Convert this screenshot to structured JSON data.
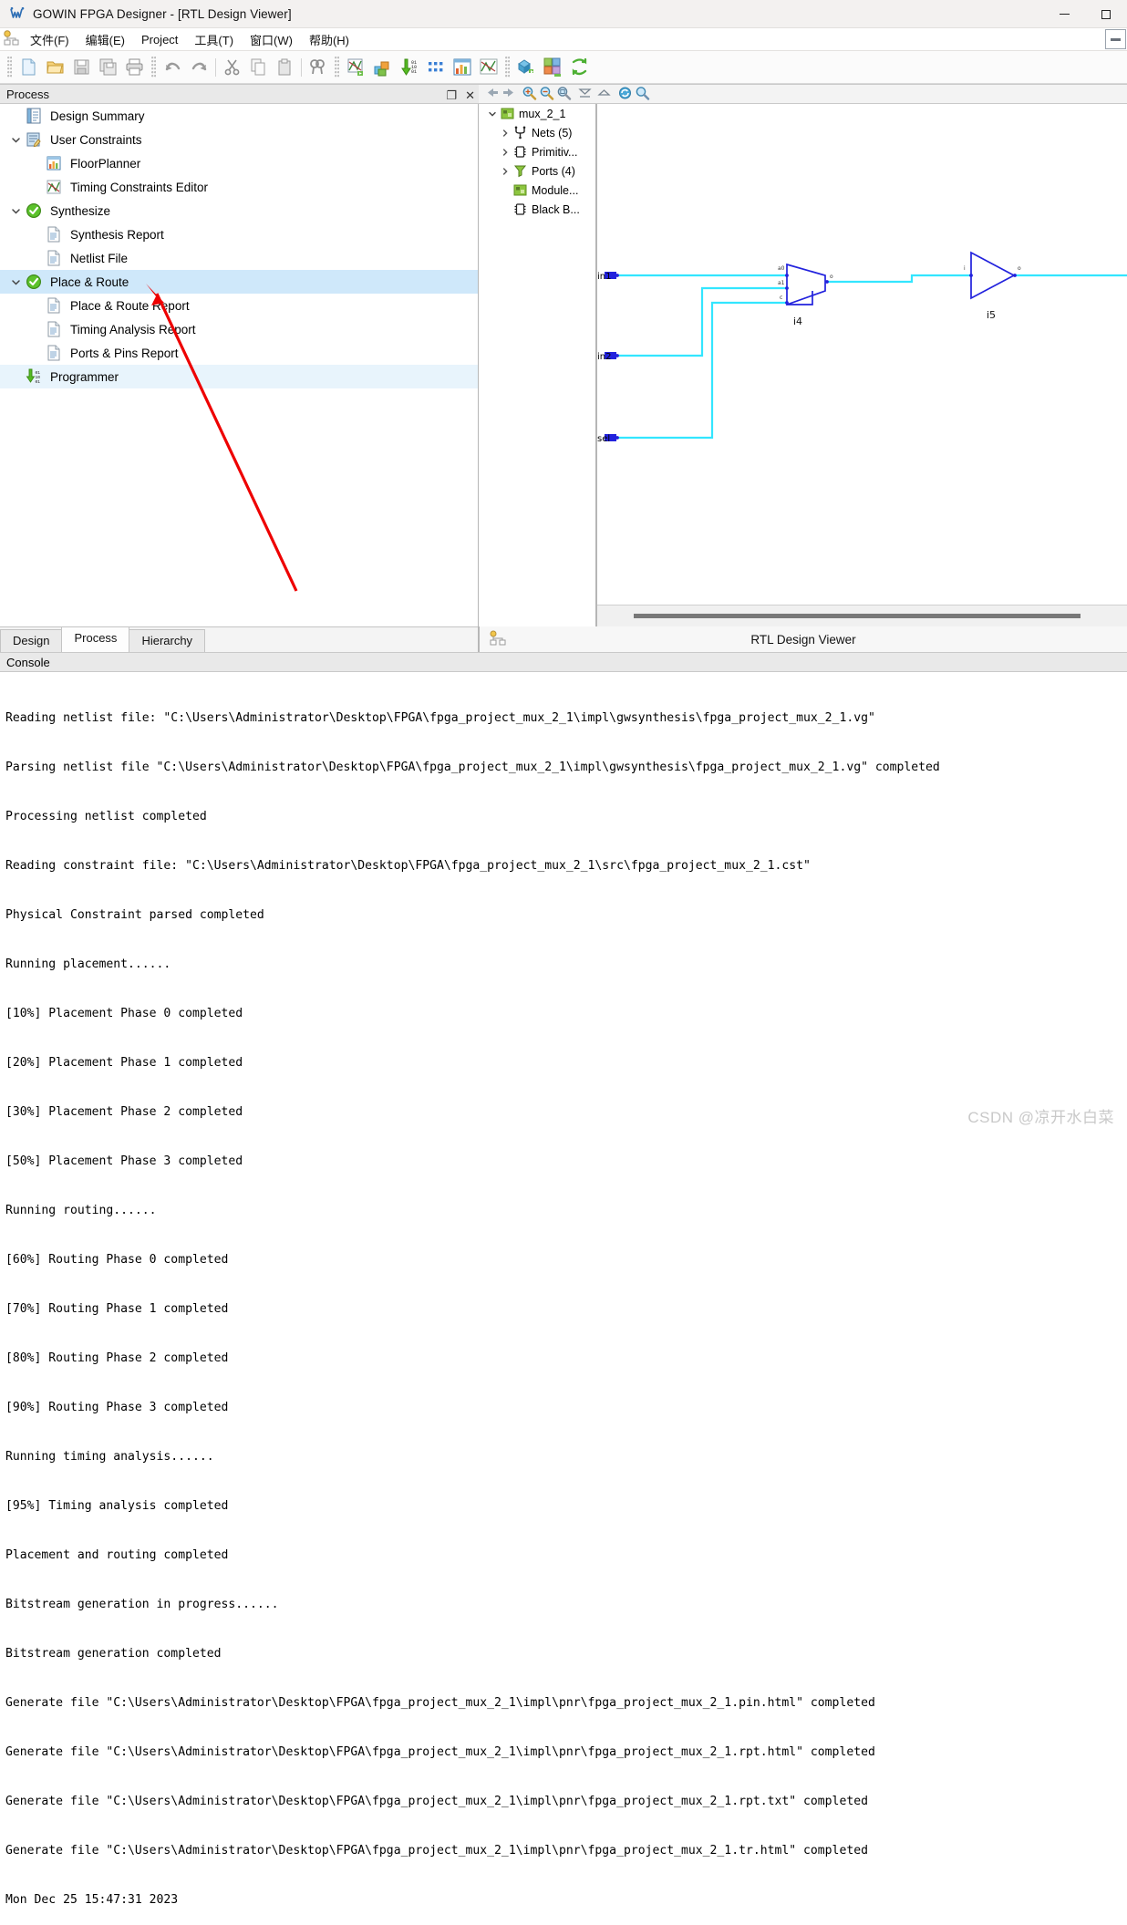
{
  "window": {
    "title": "GOWIN FPGA Designer - [RTL Design Viewer]",
    "logo_icon": "gowin-logo-icon",
    "minimize_label": "minimize-icon",
    "maximize_label": "maximize-icon"
  },
  "menubar": {
    "grip_icon": "menu-grip-icon",
    "items": [
      {
        "label": "文件(F)",
        "mnemonic": "F"
      },
      {
        "label": "编辑(E)",
        "mnemonic": "E"
      },
      {
        "label": "Project",
        "mnemonic": "P"
      },
      {
        "label": "工具(T)",
        "mnemonic": "T"
      },
      {
        "label": "窗口(W)",
        "mnemonic": "W"
      },
      {
        "label": "帮助(H)",
        "mnemonic": "H"
      }
    ],
    "right_button_icon": "restore-window-icon"
  },
  "toolbar": {
    "groups": [
      [
        "new-file-icon",
        "open-folder-icon",
        "save-icon",
        "save-all-icon",
        "print-icon"
      ],
      [
        "undo-icon",
        "redo-icon",
        "cut-icon",
        "copy-icon",
        "paste-icon",
        "find-icon"
      ],
      [
        "timing-constraints-editor-icon",
        "floorplanner-3d-icon",
        "programmer-icon",
        "dots-grid-icon",
        "floorplan-table-icon",
        "timing-chart-icon"
      ],
      [
        "synthesize-icon",
        "place-route-icon",
        "rerun-all-icon"
      ]
    ]
  },
  "process_panel": {
    "title": "Process",
    "float_button": "float-panel-icon",
    "close_button": "close-panel-icon",
    "rows": [
      {
        "label": "Design Summary",
        "icon": "design-summary-icon",
        "indent": 1,
        "twisty": "none",
        "state": "normal"
      },
      {
        "label": "User Constraints",
        "icon": "user-constraints-icon",
        "indent": 0,
        "twisty": "expanded",
        "state": "normal"
      },
      {
        "label": "FloorPlanner",
        "icon": "floorplanner-icon",
        "indent": 2,
        "twisty": "none",
        "state": "normal"
      },
      {
        "label": "Timing Constraints Editor",
        "icon": "timing-constraints-icon",
        "indent": 2,
        "twisty": "none",
        "state": "normal"
      },
      {
        "label": "Synthesize",
        "icon": "status-ok-icon",
        "indent": 0,
        "twisty": "expanded",
        "state": "normal"
      },
      {
        "label": "Synthesis Report",
        "icon": "report-icon",
        "indent": 2,
        "twisty": "none",
        "state": "normal"
      },
      {
        "label": "Netlist File",
        "icon": "report-icon",
        "indent": 2,
        "twisty": "none",
        "state": "normal"
      },
      {
        "label": "Place & Route",
        "icon": "status-ok-icon",
        "indent": 0,
        "twisty": "expanded",
        "state": "selected"
      },
      {
        "label": "Place & Route Report",
        "icon": "report-icon",
        "indent": 2,
        "twisty": "none",
        "state": "normal"
      },
      {
        "label": "Timing Analysis Report",
        "icon": "report-icon",
        "indent": 2,
        "twisty": "none",
        "state": "normal"
      },
      {
        "label": "Ports & Pins Report",
        "icon": "report-icon",
        "indent": 2,
        "twisty": "none",
        "state": "normal"
      },
      {
        "label": "Programmer",
        "icon": "programmer-icon",
        "indent": 1,
        "twisty": "none",
        "state": "hover"
      }
    ]
  },
  "viewer_toolbar": {
    "buttons": [
      "back-arrow-icon",
      "forward-arrow-icon",
      "zoom-in-icon",
      "zoom-out-icon",
      "zoom-fit-icon",
      "collapse-icon",
      "expand-icon",
      "refresh-icon",
      "search-icon"
    ]
  },
  "hierarchy": {
    "rows": [
      {
        "label": "mux_2_1",
        "icon": "module-icon",
        "twisty": "expanded",
        "indent": 0
      },
      {
        "label": "Nets (5)",
        "icon": "nets-icon",
        "twisty": "collapsed",
        "indent": 1
      },
      {
        "label": "Primitiv...",
        "icon": "primitive-icon",
        "twisty": "collapsed",
        "indent": 1
      },
      {
        "label": "Ports (4)",
        "icon": "ports-icon",
        "twisty": "collapsed",
        "indent": 1
      },
      {
        "label": "Module...",
        "icon": "module-icon",
        "twisty": "none",
        "indent": 1
      },
      {
        "label": "Black B...",
        "icon": "primitive-icon",
        "twisty": "none",
        "indent": 1
      }
    ]
  },
  "schematic": {
    "ports": [
      {
        "name": "in1",
        "type": "input"
      },
      {
        "name": "in2",
        "type": "input"
      },
      {
        "name": "sel",
        "type": "input"
      }
    ],
    "instances": [
      {
        "name": "i4",
        "type": "mux",
        "pins": [
          "a0",
          "a1",
          "c",
          "o"
        ]
      },
      {
        "name": "i5",
        "type": "inverter",
        "pins": [
          "i",
          "o"
        ]
      }
    ],
    "wire_color": "#33e6ff",
    "symbol_color": "#2222dd"
  },
  "tabs": {
    "items": [
      {
        "label": "Design",
        "active": false
      },
      {
        "label": "Process",
        "active": true
      },
      {
        "label": "Hierarchy",
        "active": false
      }
    ],
    "viewer_caption": "RTL Design Viewer",
    "viewer_tool_icon": "rtl-hierarchy-icon"
  },
  "console": {
    "title": "Console",
    "lines": [
      "Reading netlist file: \"C:\\Users\\Administrator\\Desktop\\FPGA\\fpga_project_mux_2_1\\impl\\gwsynthesis\\fpga_project_mux_2_1.vg\"",
      "Parsing netlist file \"C:\\Users\\Administrator\\Desktop\\FPGA\\fpga_project_mux_2_1\\impl\\gwsynthesis\\fpga_project_mux_2_1.vg\" completed",
      "Processing netlist completed",
      "Reading constraint file: \"C:\\Users\\Administrator\\Desktop\\FPGA\\fpga_project_mux_2_1\\src\\fpga_project_mux_2_1.cst\"",
      "Physical Constraint parsed completed",
      "Running placement......",
      "[10%] Placement Phase 0 completed",
      "[20%] Placement Phase 1 completed",
      "[30%] Placement Phase 2 completed",
      "[50%] Placement Phase 3 completed",
      "Running routing......",
      "[60%] Routing Phase 0 completed",
      "[70%] Routing Phase 1 completed",
      "[80%] Routing Phase 2 completed",
      "[90%] Routing Phase 3 completed",
      "Running timing analysis......",
      "[95%] Timing analysis completed",
      "Placement and routing completed",
      "Bitstream generation in progress......",
      "Bitstream generation completed",
      "Generate file \"C:\\Users\\Administrator\\Desktop\\FPGA\\fpga_project_mux_2_1\\impl\\pnr\\fpga_project_mux_2_1.pin.html\" completed",
      "Generate file \"C:\\Users\\Administrator\\Desktop\\FPGA\\fpga_project_mux_2_1\\impl\\pnr\\fpga_project_mux_2_1.rpt.html\" completed",
      "Generate file \"C:\\Users\\Administrator\\Desktop\\FPGA\\fpga_project_mux_2_1\\impl\\pnr\\fpga_project_mux_2_1.rpt.txt\" completed",
      "Generate file \"C:\\Users\\Administrator\\Desktop\\FPGA\\fpga_project_mux_2_1\\impl\\pnr\\fpga_project_mux_2_1.tr.html\" completed"
    ],
    "timestamp": "Mon Dec 25 15:47:31 2023"
  },
  "watermark": "CSDN @凉开水白菜",
  "colors": {
    "selection": "#cfe8fa",
    "accent_green": "#4caf32",
    "annotation_red": "#ee0000",
    "wire": "#33e6ff"
  }
}
